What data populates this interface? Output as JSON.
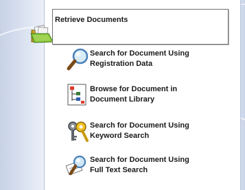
{
  "header": {
    "title": "Retrieve Documents",
    "icon": "open-folder-icon"
  },
  "options": [
    {
      "icon": "magnifier-icon",
      "line1": "Search for Document Using",
      "line2": "Registration Data"
    },
    {
      "icon": "document-tree-icon",
      "line1": "Browse for Document in",
      "line2": "Document Library"
    },
    {
      "icon": "keys-search-icon",
      "line1": "Search for Document Using",
      "line2": "Keyword Search"
    },
    {
      "icon": "document-search-icon",
      "line1": "Search for Document Using",
      "line2": "Full Text Search"
    }
  ]
}
